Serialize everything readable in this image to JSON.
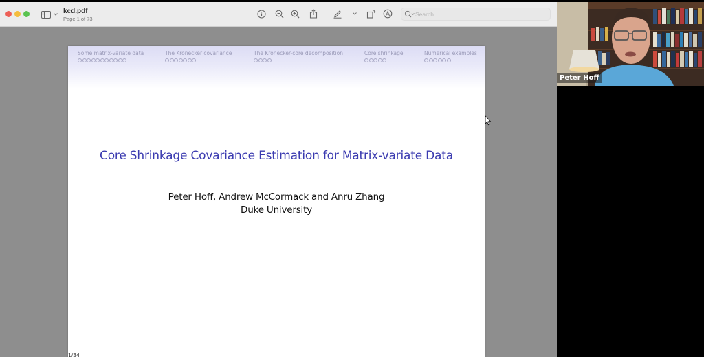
{
  "window": {
    "doc_name": "kcd.pdf",
    "page_info": "Page 1 of 73"
  },
  "toolbar": {
    "icons": [
      "info-icon",
      "zoom-out-icon",
      "zoom-in-icon",
      "share-icon",
      "markup-pen-icon",
      "chevron-down-icon",
      "rotate-icon",
      "annotate-icon"
    ],
    "search_placeholder": "Search"
  },
  "slide": {
    "nav_sections": [
      {
        "label": "Some matrix-variate data",
        "dots": 11
      },
      {
        "label": "The Kronecker covariance",
        "dots": 7
      },
      {
        "label": "The Kronecker-core decomposition",
        "dots": 4
      },
      {
        "label": "Core shrinkage",
        "dots": 5
      },
      {
        "label": "Numerical examples",
        "dots": 6
      }
    ],
    "title": "Core Shrinkage Covariance Estimation for Matrix-variate Data",
    "authors": "Peter Hoff, Andrew McCormack and Anru Zhang",
    "affiliation": "Duke University",
    "slide_number": "1/34"
  },
  "colors": {
    "title_blue": "#3b3bb0",
    "nav_text": "#9a9ab8",
    "traffic_close": "#ed5f57",
    "traffic_min": "#f5bd3e",
    "traffic_max": "#5ac350"
  },
  "video": {
    "participant_name": "Peter Hoff"
  }
}
